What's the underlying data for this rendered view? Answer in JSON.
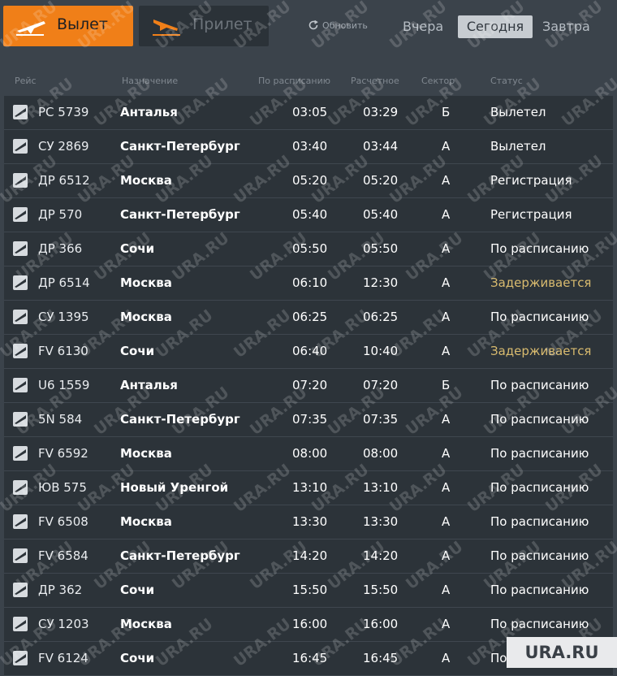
{
  "tabs": {
    "departures": "Вылет",
    "arrivals": "Прилет"
  },
  "refresh_label": "Обновить",
  "days": {
    "yesterday": "Вчера",
    "today": "Сегодня",
    "tomorrow": "Завтра"
  },
  "columns": {
    "flight": "Рейс",
    "destination": "Назначение",
    "scheduled": "По расписанию",
    "estimated": "Расчетное",
    "sector": "Сектор",
    "status": "Статус"
  },
  "flights": [
    {
      "flight": "РС 5739",
      "destination": "Анталья",
      "scheduled": "03:05",
      "estimated": "03:29",
      "sector": "Б",
      "status": "Вылетел",
      "delayed": false
    },
    {
      "flight": "СУ 2869",
      "destination": "Санкт-Петербург",
      "scheduled": "03:40",
      "estimated": "03:44",
      "sector": "А",
      "status": "Вылетел",
      "delayed": false
    },
    {
      "flight": "ДР 6512",
      "destination": "Москва",
      "scheduled": "05:20",
      "estimated": "05:20",
      "sector": "А",
      "status": "Регистрация",
      "delayed": false
    },
    {
      "flight": "ДР 570",
      "destination": "Санкт-Петербург",
      "scheduled": "05:40",
      "estimated": "05:40",
      "sector": "А",
      "status": "Регистрация",
      "delayed": false
    },
    {
      "flight": "ДР 366",
      "destination": "Сочи",
      "scheduled": "05:50",
      "estimated": "05:50",
      "sector": "А",
      "status": "По расписанию",
      "delayed": false
    },
    {
      "flight": "ДР 6514",
      "destination": "Москва",
      "scheduled": "06:10",
      "estimated": "12:30",
      "sector": "А",
      "status": "Задерживается",
      "delayed": true
    },
    {
      "flight": "СУ 1395",
      "destination": "Москва",
      "scheduled": "06:25",
      "estimated": "06:25",
      "sector": "А",
      "status": "По расписанию",
      "delayed": false
    },
    {
      "flight": "FV 6130",
      "destination": "Сочи",
      "scheduled": "06:40",
      "estimated": "10:40",
      "sector": "А",
      "status": "Задерживается",
      "delayed": true
    },
    {
      "flight": "U6 1559",
      "destination": "Анталья",
      "scheduled": "07:20",
      "estimated": "07:20",
      "sector": "Б",
      "status": "По расписанию",
      "delayed": false
    },
    {
      "flight": "5N 584",
      "destination": "Санкт-Петербург",
      "scheduled": "07:35",
      "estimated": "07:35",
      "sector": "А",
      "status": "По расписанию",
      "delayed": false
    },
    {
      "flight": "FV 6592",
      "destination": "Москва",
      "scheduled": "08:00",
      "estimated": "08:00",
      "sector": "А",
      "status": "По расписанию",
      "delayed": false
    },
    {
      "flight": "ЮВ 575",
      "destination": "Новый Уренгой",
      "scheduled": "13:10",
      "estimated": "13:10",
      "sector": "А",
      "status": "По расписанию",
      "delayed": false
    },
    {
      "flight": "FV 6508",
      "destination": "Москва",
      "scheduled": "13:30",
      "estimated": "13:30",
      "sector": "А",
      "status": "По расписанию",
      "delayed": false
    },
    {
      "flight": "FV 6584",
      "destination": "Санкт-Петербург",
      "scheduled": "14:20",
      "estimated": "14:20",
      "sector": "А",
      "status": "По расписанию",
      "delayed": false
    },
    {
      "flight": "ДР 362",
      "destination": "Сочи",
      "scheduled": "15:50",
      "estimated": "15:50",
      "sector": "А",
      "status": "По расписанию",
      "delayed": false
    },
    {
      "flight": "СУ 1203",
      "destination": "Москва",
      "scheduled": "16:00",
      "estimated": "16:00",
      "sector": "А",
      "status": "По расписанию",
      "delayed": false
    },
    {
      "flight": "FV 6124",
      "destination": "Сочи",
      "scheduled": "16:45",
      "estimated": "16:45",
      "sector": "А",
      "status": "По расписанию",
      "delayed": false
    }
  ],
  "watermark_text": "URA.RU",
  "badge_text": "URA.RU",
  "colors": {
    "accent": "#f07f18",
    "delayed": "#d9bb6f"
  }
}
